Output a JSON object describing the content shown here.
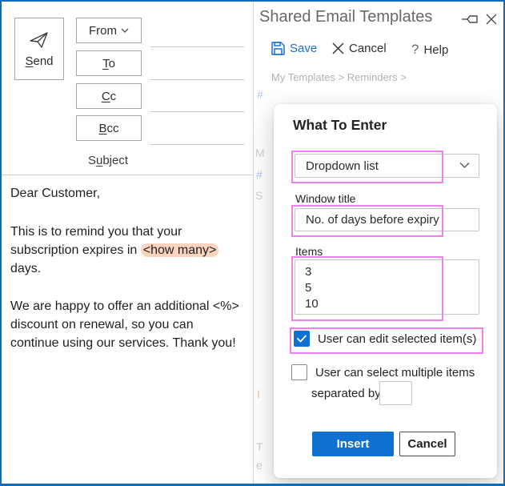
{
  "colors": {
    "window_border": "#0f6cbd",
    "accent_blue": "#0e70d1",
    "highlight_pink": "#ef81ef",
    "body_highlight": "#fbd4c0",
    "save_blue": "#1e6fc8"
  },
  "compose": {
    "send": {
      "u": "S",
      "post": "end"
    },
    "fields": [
      {
        "pre": "From",
        "u": "",
        "post": ""
      },
      {
        "pre": "",
        "u": "T",
        "post": "o"
      },
      {
        "pre": "",
        "u": "C",
        "post": "c"
      },
      {
        "pre": "",
        "u": "B",
        "post": "cc"
      }
    ],
    "subject": {
      "pre": "S",
      "u": "u",
      "post": "bject"
    },
    "body": {
      "greeting": "Dear Customer,",
      "p2_l1": "This is to remind you that your",
      "p2_l2_pre": "subscription expires in ",
      "p2_l2_highlight": "<how many>",
      "p2_l3": "days.",
      "p3_l1": "We are happy to offer an additional <%>",
      "p3_l2": "discount on renewal, so you can",
      "p3_l3": "continue using our services. Thank you!"
    }
  },
  "pane": {
    "title": "Shared Email Templates",
    "toolbar": {
      "save": "Save",
      "cancel": "Cancel",
      "help": "Help",
      "help_glyph": "?"
    },
    "breadcrumb": "My Templates > Reminders >"
  },
  "obscured_fragments": [
    "#",
    "M",
    "#",
    "S",
    "I",
    "T",
    "e"
  ],
  "dialog": {
    "title": "What To Enter",
    "type_selected": "Dropdown list",
    "window_title_label": "Window title",
    "window_title_value": "No. of days before expiry",
    "items_label": "Items",
    "items": [
      "3",
      "5",
      "10"
    ],
    "edit_checkbox": {
      "label": "User can edit selected item(s)",
      "checked": true
    },
    "multi_checkbox": {
      "label": "User can select multiple items",
      "checked": false
    },
    "separated_by_label": "separated by",
    "separated_by_value": "",
    "insert_button": "Insert",
    "cancel_button": "Cancel"
  }
}
